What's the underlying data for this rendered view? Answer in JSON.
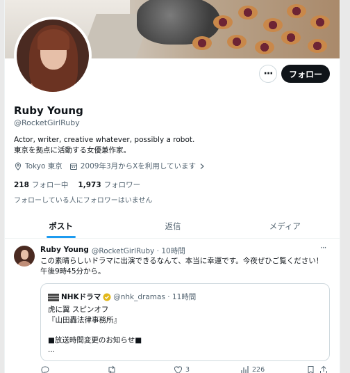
{
  "profile": {
    "name": "Ruby Young",
    "handle": "@RocketGirlRuby",
    "bio_line1": "Actor, writer, creative whatever, possibly a robot.",
    "bio_line2": "東京を拠点に活動する女優兼作家。",
    "location": "Tokyo 東京",
    "joined": "2009年3月からXを利用しています",
    "following_count": "218",
    "following_label": "フォロー中",
    "followers_count": "1,973",
    "followers_label": "フォロワー",
    "followed_by": "フォローしている人にフォロワーはいません",
    "follow_button": "フォロー",
    "more_button": "···"
  },
  "tabs": [
    {
      "label": "ポスト",
      "active": true
    },
    {
      "label": "返信",
      "active": false
    },
    {
      "label": "メディア",
      "active": false
    }
  ],
  "tweet": {
    "author": "Ruby Young",
    "handle_time": "@RocketGirlRuby · 10時間",
    "more": "···",
    "text": "この素晴らしいドラマに出演できるなんて、本当に幸運です。今夜ぜひご覧ください！ 午後9時45分から。",
    "quote": {
      "name": "NHKドラマ",
      "handle_time": "@nhk_dramas · 11時間",
      "line1": "虎に翼 スピンオフ",
      "line2": "『山田轟法律事務所』",
      "line3": "■放送時間変更のお知らせ■",
      "line4": "..."
    },
    "likes": "3",
    "views": "226"
  },
  "colors": {
    "accent": "#1d9bf0",
    "text": "#0f1419",
    "muted": "#536471",
    "verified": "#e2b719"
  }
}
